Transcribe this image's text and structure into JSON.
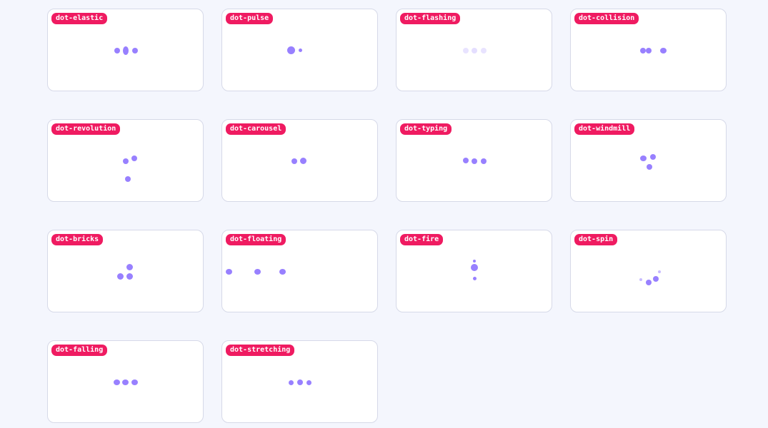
{
  "colors": {
    "background": "#f4f6fd",
    "card": "#ffffff",
    "tag": "#ef1b61",
    "dot": "#9880ff"
  },
  "cards": [
    {
      "label": "dot-elastic"
    },
    {
      "label": "dot-pulse"
    },
    {
      "label": "dot-flashing"
    },
    {
      "label": "dot-collision"
    },
    {
      "label": "dot-revolution"
    },
    {
      "label": "dot-carousel"
    },
    {
      "label": "dot-typing"
    },
    {
      "label": "dot-windmill"
    },
    {
      "label": "dot-bricks"
    },
    {
      "label": "dot-floating"
    },
    {
      "label": "dot-fire"
    },
    {
      "label": "dot-spin"
    },
    {
      "label": "dot-falling"
    },
    {
      "label": "dot-stretching"
    }
  ]
}
